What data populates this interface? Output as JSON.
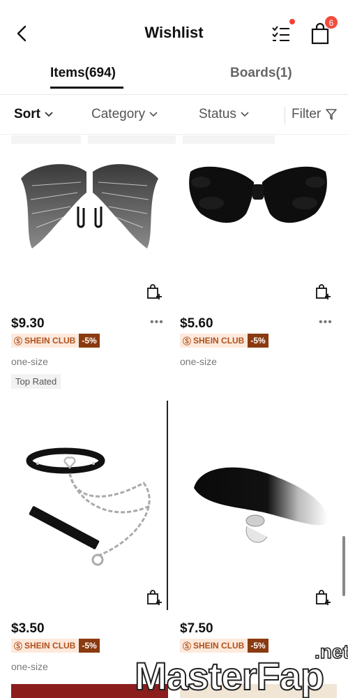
{
  "header": {
    "title": "Wishlist",
    "bag_count": "6"
  },
  "tabs": [
    {
      "label": "Items(694)",
      "active": true
    },
    {
      "label": "Boards(1)",
      "active": false
    }
  ],
  "filters": {
    "sort": "Sort",
    "category": "Category",
    "status": "Status",
    "filter": "Filter"
  },
  "club_label": "SHEIN CLUB",
  "products": [
    {
      "name": "grey feather wings",
      "price": "$9.30",
      "discount": "-5%",
      "size": "one-size",
      "badge": "Top Rated"
    },
    {
      "name": "black feather wings",
      "price": "$5.60",
      "discount": "-5%",
      "size": "one-size",
      "badge": ""
    },
    {
      "name": "choker with chain leash",
      "price": "$3.50",
      "discount": "-5%",
      "size": "one-size",
      "badge": ""
    },
    {
      "name": "black and white fur tail",
      "price": "$7.50",
      "discount": "-5%",
      "size": "",
      "badge": ""
    }
  ],
  "watermark": {
    "main": "MasterFap",
    "suffix": ".net"
  },
  "colors": {
    "accent": "#111111",
    "badge": "#f04c3e",
    "club_bg": "#fde9dc",
    "club_text": "#b0501c",
    "discount_bg": "#8a3a10"
  }
}
